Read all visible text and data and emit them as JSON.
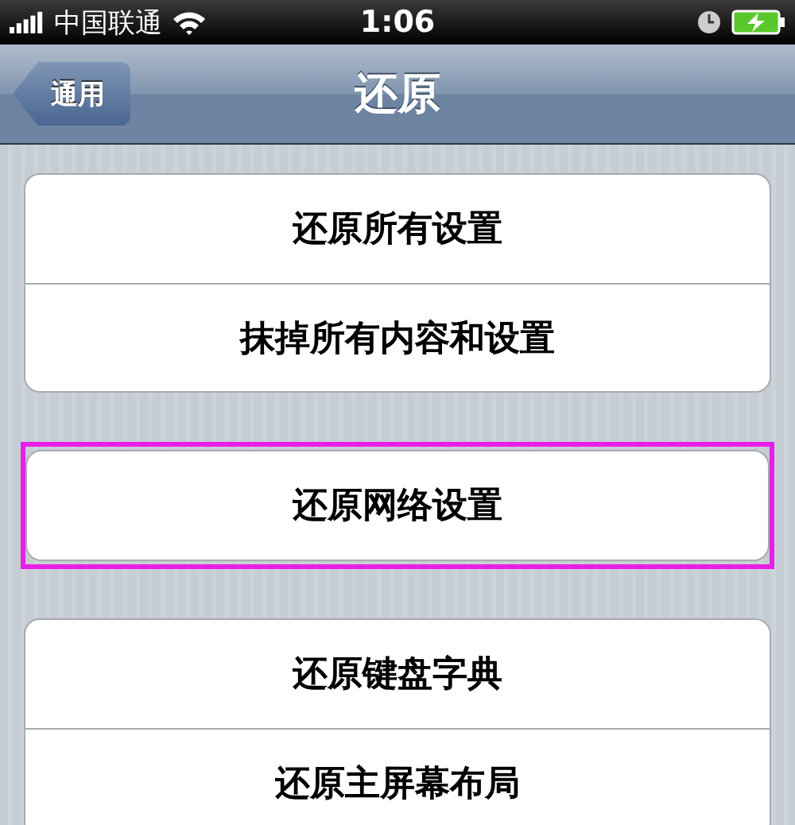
{
  "status_bar": {
    "carrier": "中国联通",
    "time": "1:06"
  },
  "nav_bar": {
    "back": "通用",
    "title": "还原"
  },
  "groups": [
    {
      "highlighted": false,
      "items": [
        "还原所有设置",
        "抹掉所有内容和设置"
      ]
    },
    {
      "highlighted": true,
      "items": [
        "还原网络设置"
      ]
    },
    {
      "highlighted": false,
      "items": [
        "还原键盘字典",
        "还原主屏幕布局"
      ]
    }
  ]
}
